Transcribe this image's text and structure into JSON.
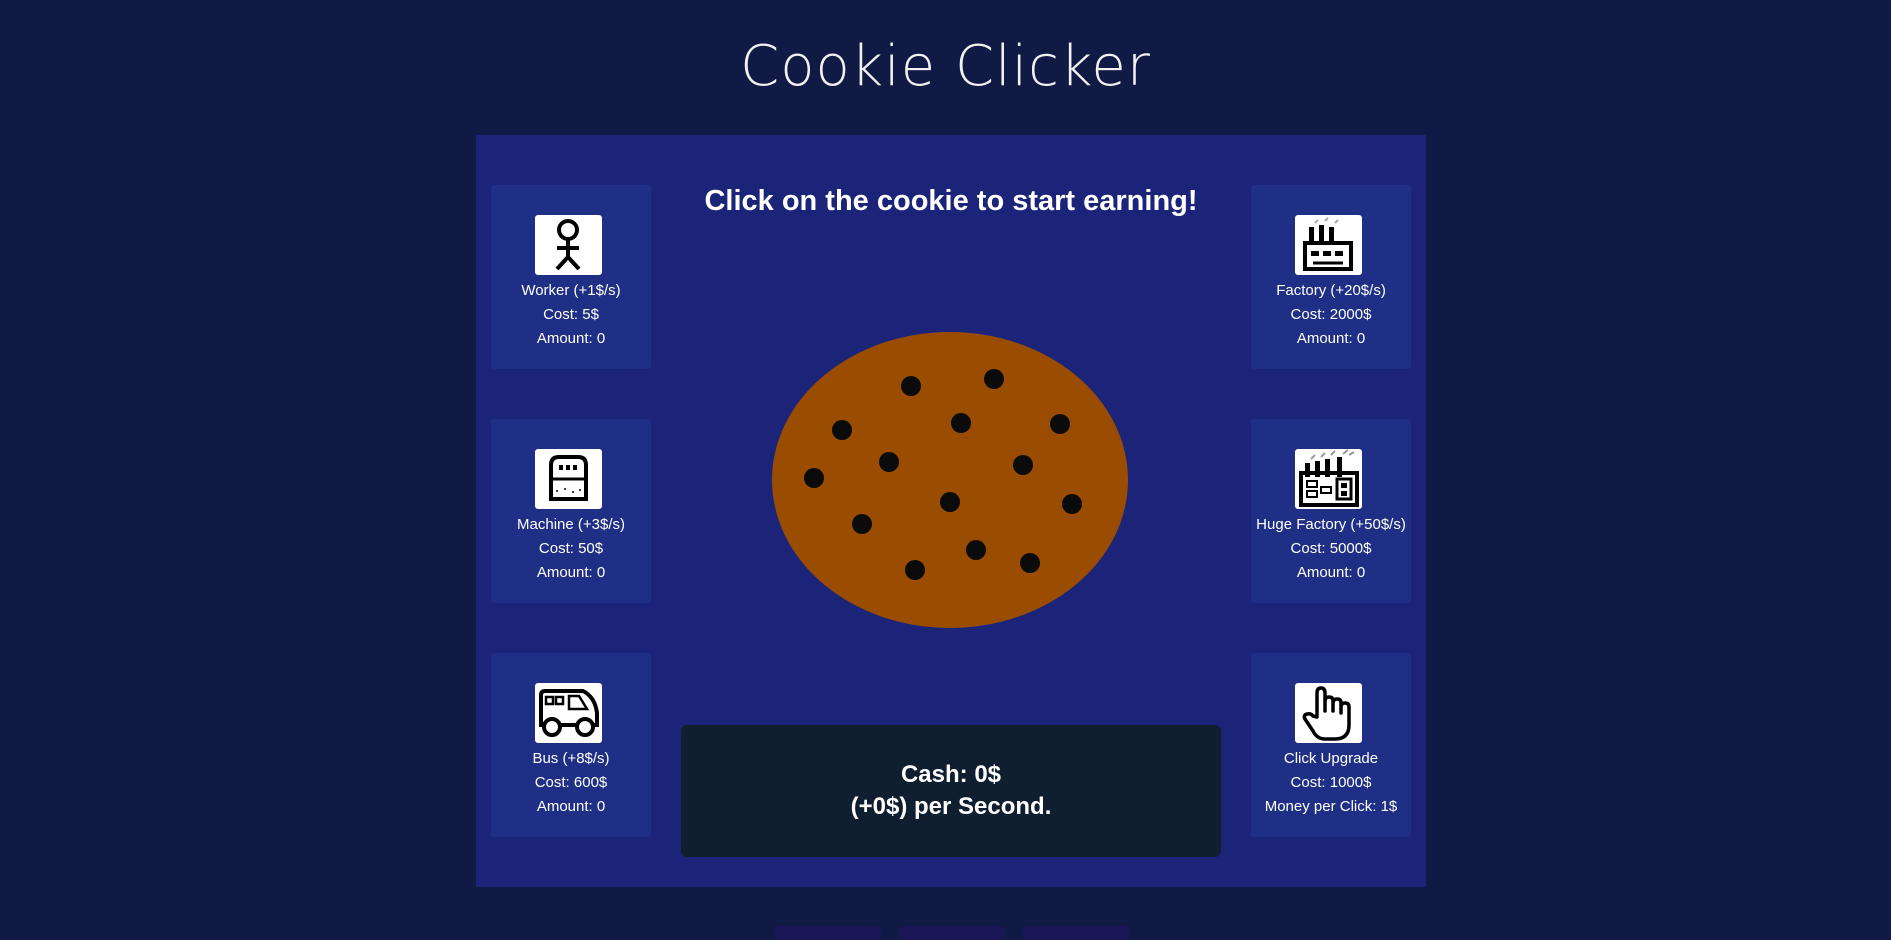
{
  "page": {
    "title": "Cookie Clicker"
  },
  "colors": {
    "background": "#111a45",
    "game_panel": "#1b2479",
    "card": "#1f2f85",
    "cookie": "#9a4d00",
    "chip": "#0b0b0b",
    "stats_panel": "#0f1f30"
  },
  "game": {
    "headline": "Click on the cookie to start earning!",
    "cash_text": "Cash: 0$",
    "rate_text": "(+0$) per Second."
  },
  "shop_left": [
    {
      "icon": "stick-figure-worker-icon",
      "name": "Worker (+1$/s)",
      "cost": "Cost: 5$",
      "amount": "Amount: 0"
    },
    {
      "icon": "machine-icon",
      "name": "Machine (+3$/s)",
      "cost": "Cost: 50$",
      "amount": "Amount: 0"
    },
    {
      "icon": "bus-icon",
      "name": "Bus (+8$/s)",
      "cost": "Cost: 600$",
      "amount": "Amount: 0"
    }
  ],
  "shop_right": [
    {
      "icon": "factory-icon",
      "name": "Factory (+20$/s)",
      "cost": "Cost: 2000$",
      "amount": "Amount: 0"
    },
    {
      "icon": "huge-factory-icon",
      "name": "Huge Factory (+50$/s)",
      "cost": "Cost: 5000$",
      "amount": "Amount: 0"
    },
    {
      "icon": "hand-icon",
      "name": "Click Upgrade",
      "cost": "Cost: 1000$",
      "amount": "Money per Click: 1$"
    }
  ]
}
